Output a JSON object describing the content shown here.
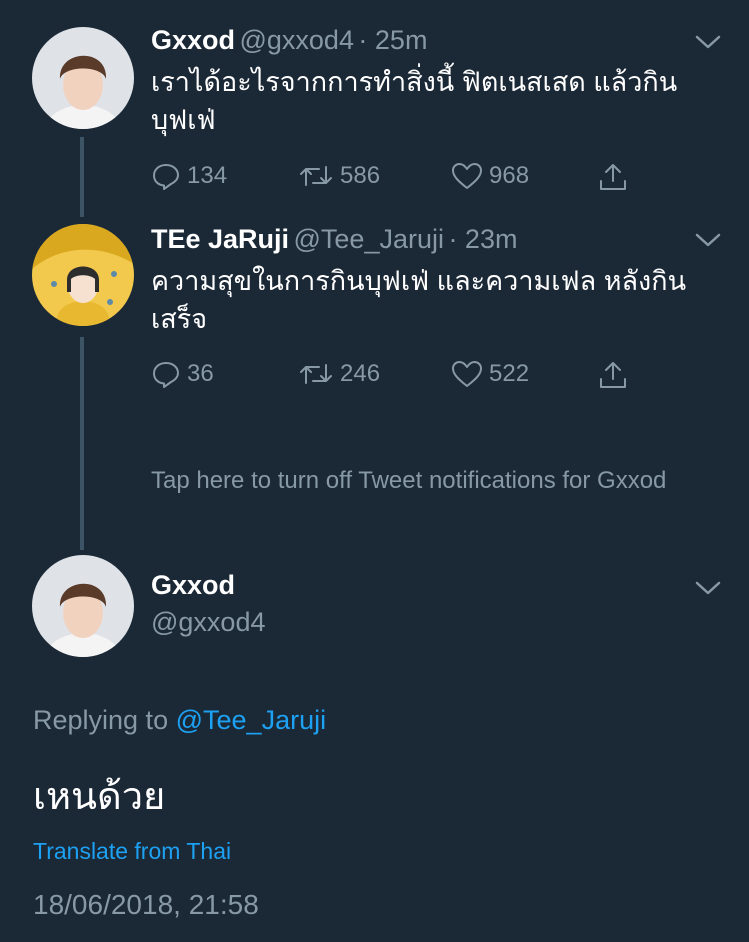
{
  "tweets": [
    {
      "name": "Gxxod",
      "handle": "@gxxod4",
      "time": "· 25m",
      "text": "เราได้อะไรจากการทำสิ่งนี้ ฟิตเนสเสด แล้วกินบุฟเฟ่",
      "reply_count": "134",
      "retweet_count": "586",
      "like_count": "968"
    },
    {
      "name": "TEe JaRuji",
      "handle": "@Tee_Jaruji",
      "time": "· 23m",
      "text": "ความสุขในการกินบุฟเฟ่ และความเฟล หลังกินเสร็จ",
      "reply_count": "36",
      "retweet_count": "246",
      "like_count": "522"
    }
  ],
  "notification_text": "Tap here to turn off Tweet notifications for Gxxod",
  "focused": {
    "name": "Gxxod",
    "handle": "@gxxod4",
    "replying_prefix": "Replying to",
    "replying_handle": "@Tee_Jaruji",
    "text": "เหนด้วย",
    "translate_label": "Translate from Thai",
    "timestamp": "18/06/2018, 21:58"
  },
  "colors": {
    "background": "#1b2836",
    "muted": "#8899a6",
    "link": "#1da1f2",
    "thread_line": "#3d5466"
  },
  "icons": [
    "reply-icon",
    "retweet-icon",
    "like-icon",
    "share-icon",
    "chevron-down-icon"
  ]
}
